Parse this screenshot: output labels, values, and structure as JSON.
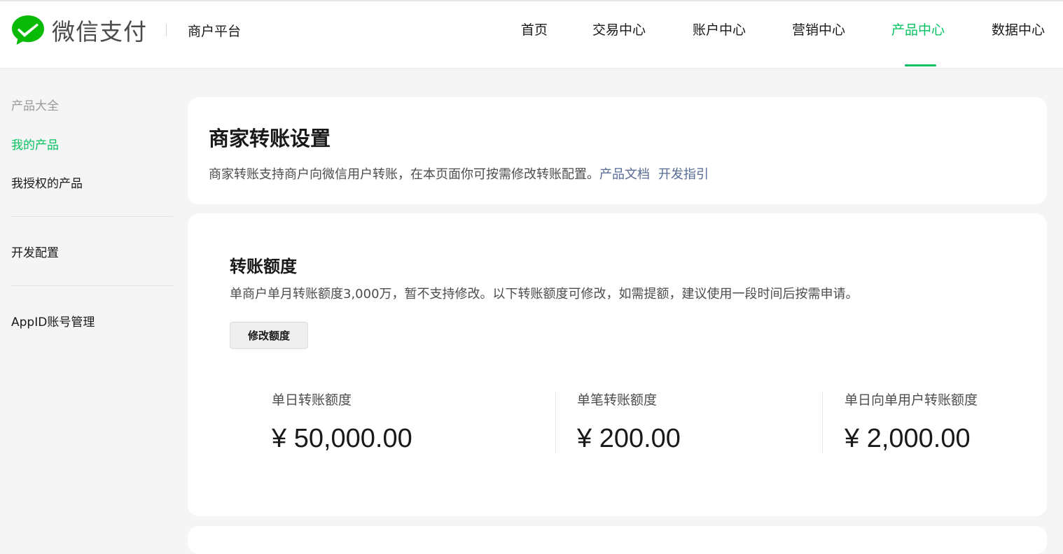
{
  "header": {
    "brand": "微信支付",
    "platform": "商户平台",
    "nav": [
      {
        "label": "首页"
      },
      {
        "label": "交易中心"
      },
      {
        "label": "账户中心"
      },
      {
        "label": "营销中心"
      },
      {
        "label": "产品中心",
        "active": true
      },
      {
        "label": "数据中心"
      }
    ],
    "brand_color": "#07c160",
    "logo_icon": "wechat-pay-logo-icon"
  },
  "sidebar": {
    "items": [
      {
        "label": "产品大全"
      },
      {
        "label": "我的产品"
      },
      {
        "label": "我授权的产品"
      },
      {
        "label": "开发配置"
      },
      {
        "label": "AppID账号管理"
      }
    ]
  },
  "intro": {
    "title": "商家转账设置",
    "description": "商家转账支持商户向微信用户转账，在本页面你可按需修改转账配置。",
    "link_docs": "产品文档",
    "link_guide": "开发指引",
    "link_color": "#576b95"
  },
  "quota": {
    "title": "转账额度",
    "description": "单商户单月转账额度3,000万，暂不支持修改。以下转账额度可修改，如需提额，建议使用一段时间后按需申请。",
    "modify_button": "修改额度",
    "stats": [
      {
        "label": "单日转账额度",
        "value": "¥ 50,000.00"
      },
      {
        "label": "单笔转账额度",
        "value": "¥ 200.00"
      },
      {
        "label": "单日向单用户转账额度",
        "value": "¥ 2,000.00"
      }
    ]
  }
}
